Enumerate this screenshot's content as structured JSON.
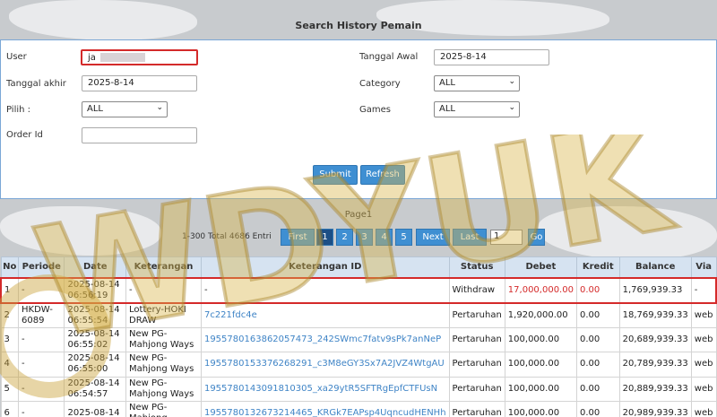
{
  "page_title": "Search History Pemain",
  "form": {
    "user_label": "User",
    "user_value": "ja",
    "tanggal_awal_label": "Tanggal Awal",
    "tanggal_awal_value": "2025-8-14",
    "tanggal_akhir_label": "Tanggal akhir",
    "tanggal_akhir_value": "2025-8-14",
    "category_label": "Category",
    "category_value": "ALL",
    "pilih_label": "Pilih  :",
    "pilih_value": "ALL",
    "games_label": "Games",
    "games_value": "ALL",
    "order_id_label": "Order Id",
    "order_id_value": "",
    "submit_label": "Submit",
    "refresh_label": "Refresh"
  },
  "pagination": {
    "title": "Page1",
    "info": "1-300 Total 4686 Entri",
    "first": "First",
    "pages": [
      "1",
      "2",
      "3",
      "4",
      "5"
    ],
    "active_page": "1",
    "next": "Next",
    "last": "Last",
    "jump_value": "1",
    "go": "Go"
  },
  "table": {
    "headers": [
      "No",
      "Periode",
      "Date",
      "Keterangan",
      "Keterangan ID",
      "Status",
      "Debet",
      "Kredit",
      "Balance",
      "Via"
    ],
    "rows": [
      {
        "no": "1",
        "periode": "-",
        "date": "2025-08-14 06:56:19",
        "ket": "-",
        "ket_id": "-",
        "status": "Withdraw",
        "debet": "17,000,000.00",
        "kredit": "0.00",
        "balance": "1,769,939.33",
        "via": "-"
      },
      {
        "no": "2",
        "periode": "HKDW-6089",
        "date": "2025-08-14 06:55:54",
        "ket": "Lottery-HOKI DRAW",
        "ket_id": "7c221fdc4e",
        "status": "Pertaruhan",
        "debet": "1,920,000.00",
        "kredit": "0.00",
        "balance": "18,769,939.33",
        "via": "web"
      },
      {
        "no": "3",
        "periode": "-",
        "date": "2025-08-14 06:55:02",
        "ket": "New PG-Mahjong Ways",
        "ket_id": "1955780163862057473_242SWmc7fatv9sPk7anNeP",
        "status": "Pertaruhan",
        "debet": "100,000.00",
        "kredit": "0.00",
        "balance": "20,689,939.33",
        "via": "web"
      },
      {
        "no": "4",
        "periode": "-",
        "date": "2025-08-14 06:55:00",
        "ket": "New PG-Mahjong Ways",
        "ket_id": "1955780153376268291_c3M8eGY3Sx7A2JVZ4WtgAU",
        "status": "Pertaruhan",
        "debet": "100,000.00",
        "kredit": "0.00",
        "balance": "20,789,939.33",
        "via": "web"
      },
      {
        "no": "5",
        "periode": "-",
        "date": "2025-08-14 06:54:57",
        "ket": "New PG-Mahjong Ways",
        "ket_id": "1955780143091810305_xa29ytR5SFTRgEpfCTFUsN",
        "status": "Pertaruhan",
        "debet": "100,000.00",
        "kredit": "0.00",
        "balance": "20,889,939.33",
        "via": "web"
      },
      {
        "no": "6",
        "periode": "-",
        "date": "2025-08-14",
        "ket": "New PG-Mahjong",
        "ket_id": "1955780132673214465_KRGk7EAPsp4UqncudHENHh",
        "status": "Pertaruhan",
        "debet": "100,000.00",
        "kredit": "0.00",
        "balance": "20,989,939.33",
        "via": "web"
      }
    ]
  },
  "watermark_text": "WDYUK",
  "colors": {
    "accent": "#3f8fd2",
    "highlight": "#d42a2a",
    "link": "#3f84c6"
  }
}
